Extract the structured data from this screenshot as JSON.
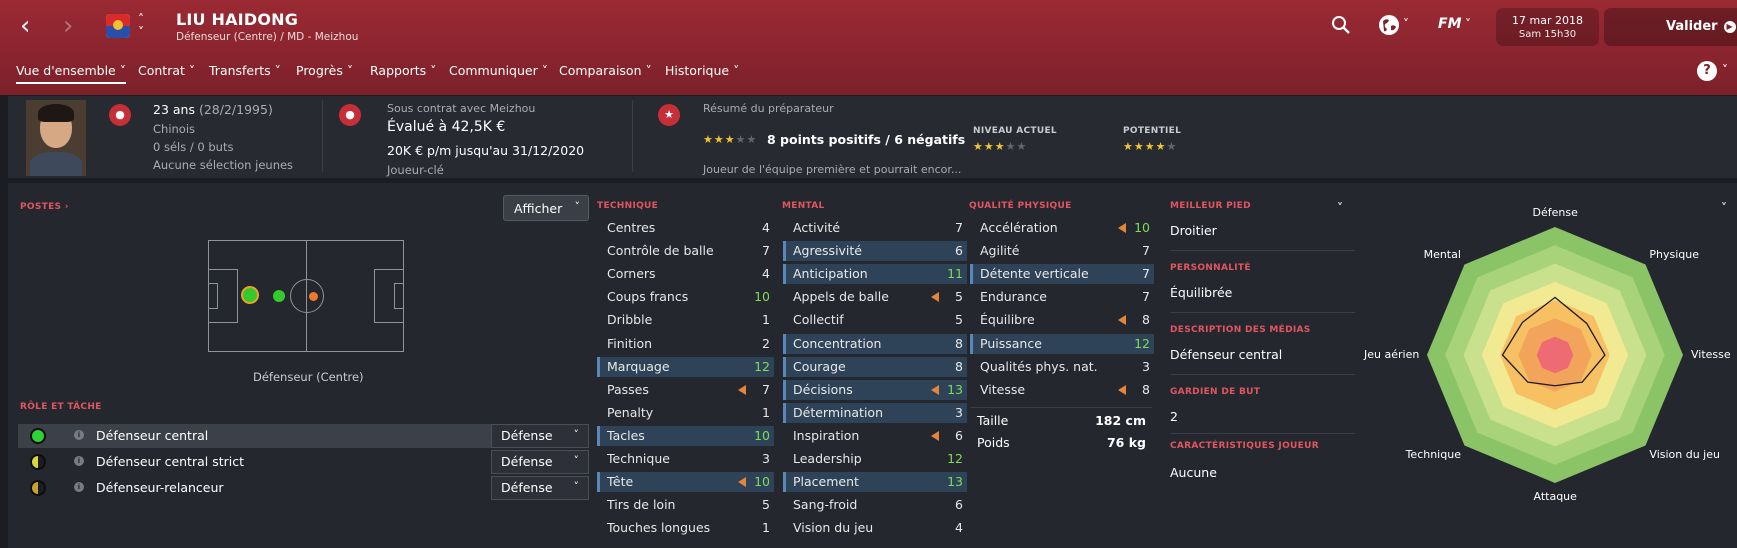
{
  "header": {
    "player_name": "LIU HAIDONG",
    "player_sub": "Défenseur (Centre) / MD - Meizhou",
    "date_line1": "17 mar 2018",
    "date_line2": "Sam 15h30",
    "fm_label": "FM",
    "validate_label": "Valider"
  },
  "menu": [
    {
      "label": "Vue d'ensemble"
    },
    {
      "label": "Contrat"
    },
    {
      "label": "Transferts"
    },
    {
      "label": "Progrès"
    },
    {
      "label": "Rapports"
    },
    {
      "label": "Communiquer"
    },
    {
      "label": "Comparaison"
    },
    {
      "label": "Historique"
    }
  ],
  "help_label": "?",
  "info": {
    "age": "23 ans",
    "dob": "(28/2/1995)",
    "nationality": "Chinois",
    "caps": "0 séls / 0 buts",
    "youth": "Aucune sélection jeunes",
    "contract_with": "Sous contrat avec Meizhou",
    "value": "Évalué à 42,5K €",
    "wage": "20K € p/m jusqu'au 31/12/2020",
    "status": "Joueur-clé",
    "coach_title": "Résumé du préparateur",
    "coach_rating": 3,
    "coach_summary": "8 points positifs / 6 négatifs",
    "coach_note": "Joueur de l'équipe première et pourrait encor...",
    "current_label": "NIVEAU ACTUEL",
    "current_stars": 3,
    "potential_label": "POTENTIEL",
    "potential_stars": 4
  },
  "positions": {
    "title": "POSTES",
    "dropdown": "Afficher",
    "position_name": "Défenseur (Centre)"
  },
  "roles": {
    "title": "RÔLE ET TÂCHE",
    "items": [
      {
        "name": "Défenseur central",
        "duty": "Défense",
        "icon_color": "#2fd335"
      },
      {
        "name": "Défenseur central strict",
        "duty": "Défense",
        "icon_color": "#d8d83a"
      },
      {
        "name": "Défenseur-relanceur",
        "duty": "Défense",
        "icon_color": "#c8a22e"
      }
    ]
  },
  "technique": {
    "title": "TECHNIQUE",
    "attrs": [
      {
        "name": "Centres",
        "value": "4",
        "hl": false,
        "trend": false
      },
      {
        "name": "Contrôle de balle",
        "value": "7",
        "hl": false,
        "trend": false
      },
      {
        "name": "Corners",
        "value": "4",
        "hl": false,
        "trend": false
      },
      {
        "name": "Coups francs",
        "value": "10",
        "hl": false,
        "trend": false
      },
      {
        "name": "Dribble",
        "value": "1",
        "hl": false,
        "trend": false
      },
      {
        "name": "Finition",
        "value": "2",
        "hl": false,
        "trend": false
      },
      {
        "name": "Marquage",
        "value": "12",
        "hl": true,
        "trend": false
      },
      {
        "name": "Passes",
        "value": "7",
        "hl": false,
        "trend": true
      },
      {
        "name": "Penalty",
        "value": "1",
        "hl": false,
        "trend": false
      },
      {
        "name": "Tacles",
        "value": "10",
        "hl": true,
        "trend": false
      },
      {
        "name": "Technique",
        "value": "3",
        "hl": false,
        "trend": false
      },
      {
        "name": "Tête",
        "value": "10",
        "hl": true,
        "trend": true
      },
      {
        "name": "Tirs de loin",
        "value": "5",
        "hl": false,
        "trend": false
      },
      {
        "name": "Touches longues",
        "value": "1",
        "hl": false,
        "trend": false
      }
    ]
  },
  "mental": {
    "title": "MENTAL",
    "attrs": [
      {
        "name": "Activité",
        "value": "7",
        "hl": false,
        "trend": false
      },
      {
        "name": "Agressivité",
        "value": "6",
        "hl": true,
        "trend": false
      },
      {
        "name": "Anticipation",
        "value": "11",
        "hl": true,
        "trend": false
      },
      {
        "name": "Appels de balle",
        "value": "5",
        "hl": false,
        "trend": true
      },
      {
        "name": "Collectif",
        "value": "5",
        "hl": false,
        "trend": false
      },
      {
        "name": "Concentration",
        "value": "8",
        "hl": true,
        "trend": false
      },
      {
        "name": "Courage",
        "value": "8",
        "hl": true,
        "trend": false
      },
      {
        "name": "Décisions",
        "value": "13",
        "hl": true,
        "trend": true
      },
      {
        "name": "Détermination",
        "value": "3",
        "hl": true,
        "trend": false
      },
      {
        "name": "Inspiration",
        "value": "6",
        "hl": false,
        "trend": true
      },
      {
        "name": "Leadership",
        "value": "12",
        "hl": false,
        "trend": false
      },
      {
        "name": "Placement",
        "value": "13",
        "hl": true,
        "trend": false
      },
      {
        "name": "Sang-froid",
        "value": "6",
        "hl": false,
        "trend": false
      },
      {
        "name": "Vision du jeu",
        "value": "4",
        "hl": false,
        "trend": false
      }
    ]
  },
  "physical": {
    "title": "QUALITÉ PHYSIQUE",
    "attrs": [
      {
        "name": "Accélération",
        "value": "10",
        "hl": false,
        "trend": true
      },
      {
        "name": "Agilité",
        "value": "7",
        "hl": false,
        "trend": false
      },
      {
        "name": "Détente verticale",
        "value": "7",
        "hl": true,
        "trend": false
      },
      {
        "name": "Endurance",
        "value": "7",
        "hl": false,
        "trend": false
      },
      {
        "name": "Équilibre",
        "value": "8",
        "hl": false,
        "trend": true
      },
      {
        "name": "Puissance",
        "value": "12",
        "hl": true,
        "trend": false
      },
      {
        "name": "Qualités phys. nat.",
        "value": "3",
        "hl": false,
        "trend": false
      },
      {
        "name": "Vitesse",
        "value": "8",
        "hl": false,
        "trend": true
      }
    ],
    "height_label": "Taille",
    "height_value": "182 cm",
    "weight_label": "Poids",
    "weight_value": "76 kg"
  },
  "profile": {
    "foot_title": "MEILLEUR PIED",
    "foot_value": "Droitier",
    "personality_title": "PERSONNALITÉ",
    "personality_value": "Équilibrée",
    "media_title": "DESCRIPTION DES MÉDIAS",
    "media_value": "Défenseur central",
    "gk_title": "GARDIEN DE BUT",
    "gk_value": "2",
    "traits_title": "CARACTÉRISTIQUES JOUEUR",
    "traits_value": "Aucune"
  },
  "radar": {
    "labels": [
      "Défense",
      "Physique",
      "Vitesse",
      "Vision du jeu",
      "Attaque",
      "Technique",
      "Jeu aérien",
      "Mental"
    ],
    "values": [
      0.45,
      0.35,
      0.39,
      0.3,
      0.24,
      0.3,
      0.41,
      0.36
    ],
    "ring_colors": [
      "#8bc467",
      "#a8d37b",
      "#c9e08d",
      "#f1ea93",
      "#f6c063",
      "#f2a55a",
      "#ee6b74"
    ]
  },
  "icons": [
    "back-arrow-icon",
    "forward-arrow-icon",
    "search-icon",
    "globe-icon",
    "star-icon",
    "chevron-down-icon",
    "info-icon"
  ]
}
